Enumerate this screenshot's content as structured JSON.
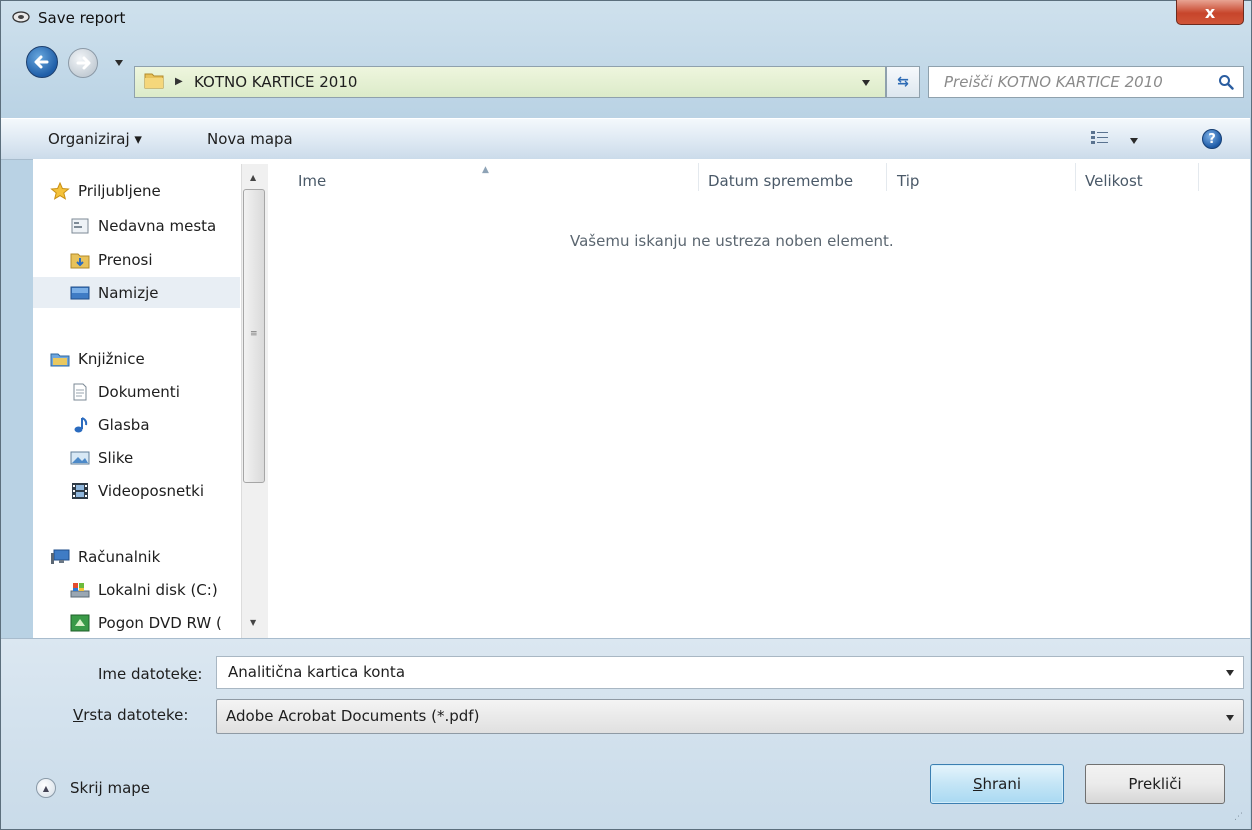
{
  "window": {
    "title": "Save report",
    "close_label": "x"
  },
  "address": {
    "path": "KOTNO KARTICE 2010"
  },
  "search": {
    "placeholder": "Preišči KOTNO KARTICE 2010"
  },
  "toolbar": {
    "organize_label": "Organiziraj ▾",
    "new_folder_label": "Nova mapa"
  },
  "nav_pane": {
    "favorites": {
      "header": "Priljubljene",
      "items": [
        "Nedavna mesta",
        "Prenosi",
        "Namizje"
      ]
    },
    "libraries": {
      "header": "Knjižnice",
      "items": [
        "Dokumenti",
        "Glasba",
        "Slike",
        "Videoposnetki"
      ]
    },
    "computer": {
      "header": "Računalnik",
      "items": [
        "Lokalni disk (C:)",
        "Pogon DVD RW ("
      ]
    },
    "selected": "Namizje"
  },
  "file_list": {
    "columns": [
      "Ime",
      "Datum spremembe",
      "Tip",
      "Velikost"
    ],
    "empty_message": "Vašemu iskanju ne ustreza noben element."
  },
  "form": {
    "filename_label_pre": "Ime datotek",
    "filename_label_ul": "e",
    "filename_label_post": ":",
    "filename_value": "Analitična kartica konta",
    "filetype_label_ul": "V",
    "filetype_label_post": "rsta datoteke:",
    "filetype_value": "Adobe Acrobat Documents (*.pdf)"
  },
  "footer": {
    "hide_folders_label": "Skrij mape",
    "save_label_ul": "S",
    "save_label_post": "hrani",
    "cancel_label": "Prekliči"
  },
  "colors": {
    "accent": "#1f5ea8",
    "selected_bg": "#e8eef4",
    "close_red": "#c7452b"
  }
}
